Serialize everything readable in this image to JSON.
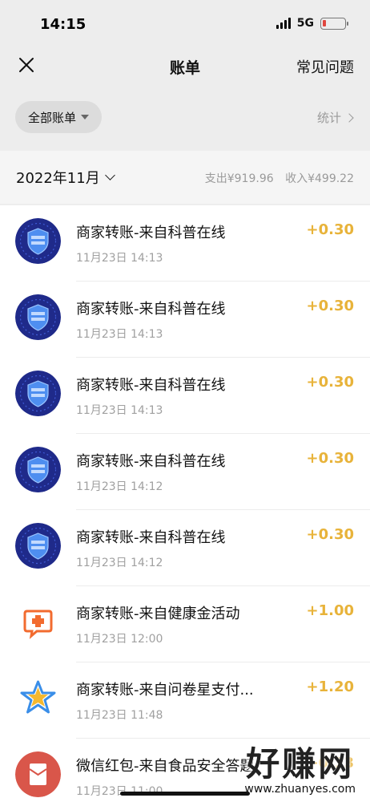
{
  "status": {
    "time": "14:15",
    "network": "5G",
    "battery_level": 0.1
  },
  "nav": {
    "title": "账单",
    "faq": "常见问题"
  },
  "filter": {
    "all_bills": "全部账单",
    "stats": "统计"
  },
  "month": {
    "label": "2022年11月",
    "expense": "支出¥919.96",
    "income": "收入¥499.22"
  },
  "transactions": [
    {
      "title": "商家转账-来自科普在线",
      "time": "11月23日 14:13",
      "amount": "+0.30",
      "icon": "science-shield-icon"
    },
    {
      "title": "商家转账-来自科普在线",
      "time": "11月23日 14:13",
      "amount": "+0.30",
      "icon": "science-shield-icon"
    },
    {
      "title": "商家转账-来自科普在线",
      "time": "11月23日 14:13",
      "amount": "+0.30",
      "icon": "science-shield-icon"
    },
    {
      "title": "商家转账-来自科普在线",
      "time": "11月23日 14:12",
      "amount": "+0.30",
      "icon": "science-shield-icon"
    },
    {
      "title": "商家转账-来自科普在线",
      "time": "11月23日 14:12",
      "amount": "+0.30",
      "icon": "science-shield-icon"
    },
    {
      "title": "商家转账-来自健康金活动",
      "time": "11月23日 12:00",
      "amount": "+1.00",
      "icon": "medical-chat-icon"
    },
    {
      "title": "商家转账-来自问卷星支付...",
      "time": "11月23日 11:48",
      "amount": "+1.20",
      "icon": "star-icon"
    },
    {
      "title": "微信红包-来自食品安全答题",
      "time": "11月23日 11:00",
      "amount": "+0.13",
      "icon": "red-envelope-icon"
    }
  ],
  "watermark": {
    "logo": "好赚网",
    "url": "www.zhuanyes.com"
  },
  "colors": {
    "amount": "#e8b33a",
    "background": "#ededed",
    "list_background": "#ffffff"
  }
}
